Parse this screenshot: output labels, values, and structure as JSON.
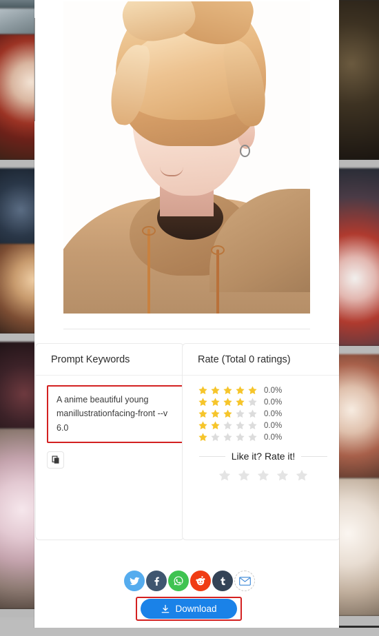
{
  "artwork": {
    "name": "anime-boy-portrait",
    "alt": "Anime illustration of a young man with blonde hair, amber eyes and a tan hoodie, facing front"
  },
  "prompt_panel": {
    "title": "Prompt Keywords",
    "prompt_text": "A anime beautiful young manillustrationfacing-front --v 6.0",
    "copy_icon": "copy-icon",
    "highlight_color": "#d32020"
  },
  "rate_panel": {
    "title": "Rate (Total 0 ratings)",
    "rows": [
      {
        "filled": 5,
        "percent": "0.0%"
      },
      {
        "filled": 4,
        "percent": "0.0%"
      },
      {
        "filled": 3,
        "percent": "0.0%"
      },
      {
        "filled": 2,
        "percent": "0.0%"
      },
      {
        "filled": 1,
        "percent": "0.0%"
      }
    ],
    "rate_prompt": "Like it? Rate it!",
    "interactive_stars": 5,
    "star_filled_color": "#f6c52b",
    "star_empty_color": "#dcdcdc",
    "star_big_empty_color": "#e4e4e4"
  },
  "share": {
    "items": [
      {
        "name": "twitter-share-icon",
        "glyph": "twitter",
        "color": "#55acee"
      },
      {
        "name": "facebook-share-icon",
        "glyph": "facebook",
        "color": "#3f5670"
      },
      {
        "name": "whatsapp-share-icon",
        "glyph": "whatsapp",
        "color": "#3fc351"
      },
      {
        "name": "reddit-share-icon",
        "glyph": "reddit",
        "color": "#f03c14"
      },
      {
        "name": "tumblr-share-icon",
        "glyph": "tumblr",
        "color": "#344356"
      },
      {
        "name": "email-share-icon",
        "glyph": "email",
        "color": "#ffffff"
      }
    ]
  },
  "download": {
    "label": "Download",
    "icon": "download-icon",
    "button_color": "#1a82e8",
    "highlight_color": "#d32020"
  }
}
